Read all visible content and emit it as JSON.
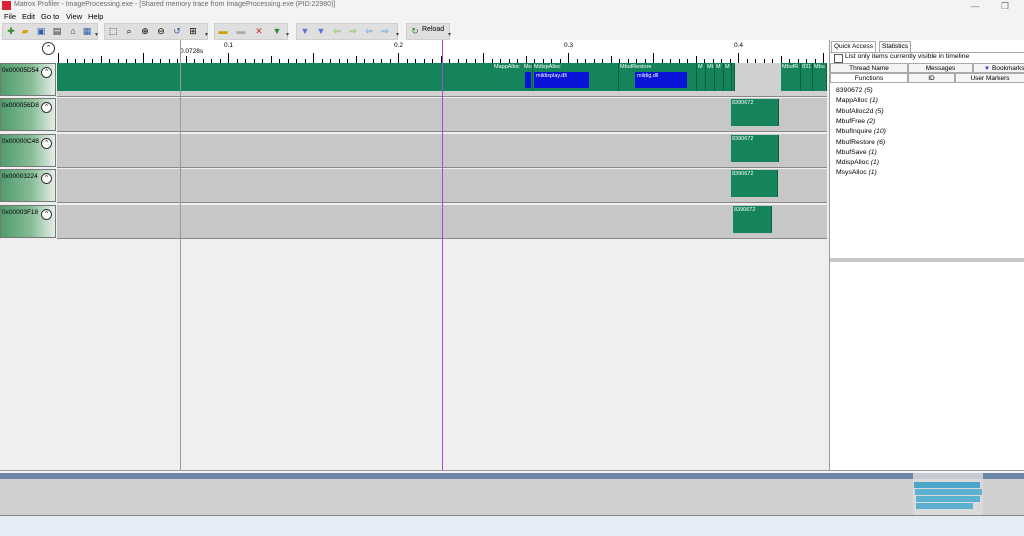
{
  "window": {
    "title": "Matrox Profiler - ImageProcessing.exe - [Shared memory trace from ImageProcessing.exe (PID:22980)]"
  },
  "menu": [
    "File",
    "Edit",
    "Go to",
    "View",
    "Help"
  ],
  "toolbar": {
    "reload_label": "Reload"
  },
  "ruler": {
    "cursor_label": "0.0728s",
    "major_labels": [
      "0.1",
      "0.2",
      "0.3",
      "0.4"
    ]
  },
  "threads": [
    {
      "id": "0x00005D54",
      "collapse": "^"
    },
    {
      "id": "0x000056D8",
      "collapse": "^"
    },
    {
      "id": "0x00000C48",
      "collapse": "^"
    },
    {
      "id": "0x00003224",
      "collapse": "^"
    },
    {
      "id": "0x00003F18",
      "collapse": "^"
    }
  ],
  "blocks": {
    "t0": [
      "MappAlloc",
      "Mo",
      "MdispAlloc",
      "mildisplay.dll",
      "MbufRestore",
      "mildig.dll",
      "M",
      "Mt",
      "M",
      "M",
      "MbufR",
      "831",
      "Mbu"
    ],
    "t1": "8390672",
    "t2": "8390672",
    "t3": "8390672",
    "t4": "8390672"
  },
  "panel": {
    "tabs": [
      "Quick Access",
      "Statistics"
    ],
    "checkbox_label": "List only items currently visible in timeline",
    "headers_row1": [
      "Thread Name",
      "Messages",
      "Bookmarks"
    ],
    "headers_row2": [
      "Functions",
      "ID",
      "User Markers"
    ],
    "functions": [
      {
        "name": "8390672",
        "count": "(5)"
      },
      {
        "name": "MappAlloc",
        "count": "(1)"
      },
      {
        "name": "MbufAlloc2d",
        "count": "(5)"
      },
      {
        "name": "MbufFree",
        "count": "(2)"
      },
      {
        "name": "MbufInquire",
        "count": "(10)"
      },
      {
        "name": "MbufRestore",
        "count": "(6)"
      },
      {
        "name": "MbufSave",
        "count": "(1)"
      },
      {
        "name": "MdispAlloc",
        "count": "(1)"
      },
      {
        "name": "MsysAlloc",
        "count": "(1)"
      }
    ]
  }
}
